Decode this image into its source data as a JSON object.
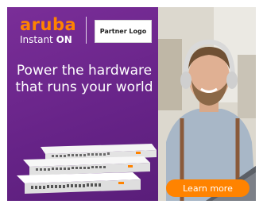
{
  "brand": {
    "logo_main": "aruba",
    "logo_sub_prefix": "Instant ",
    "logo_sub_suffix": "ON"
  },
  "partner": {
    "label": "Partner Logo"
  },
  "headline": {
    "text": "Power the hardware that runs your world"
  },
  "cta": {
    "label": "Learn more"
  },
  "colors": {
    "accent": "#ff8300",
    "panel": "#6d2a8e"
  }
}
